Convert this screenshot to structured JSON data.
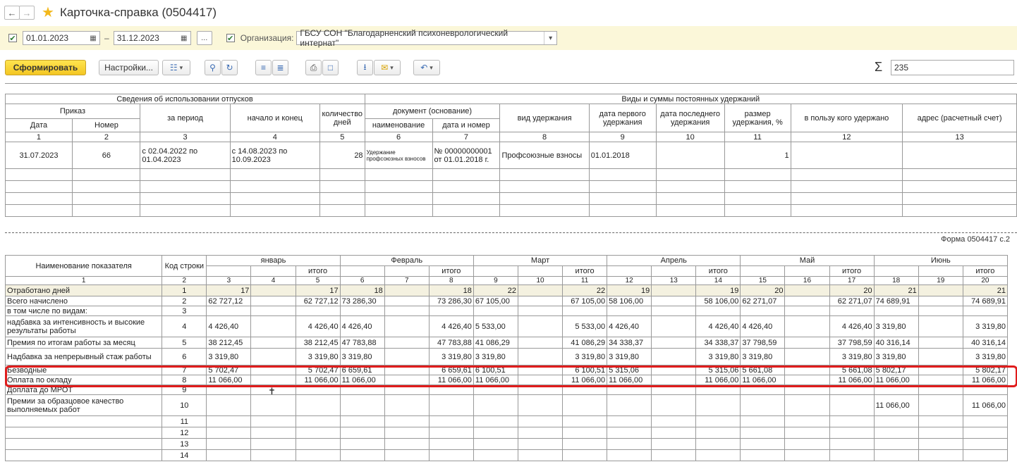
{
  "window": {
    "title": "Карточка-справка (0504417)"
  },
  "filter": {
    "date_from": "01.01.2023",
    "date_sep": "–",
    "date_to": "31.12.2023",
    "dots": "...",
    "org_label": "Организация:",
    "org_value": "ГБСУ СОН \"Благодарненский психоневрологический интернат\""
  },
  "toolbar": {
    "generate": "Сформировать",
    "settings": "Настройки...",
    "sum_value": "235"
  },
  "top_table": {
    "group1": "Сведения об использовании отпусков",
    "group2": "Виды и суммы постоянных удержаний",
    "order": "Приказ",
    "date": "Дата",
    "number": "Номер",
    "period": "за период",
    "start_end": "начало и конец",
    "days": "количество дней",
    "document": "документ (основание)",
    "doc_name": "наименование",
    "doc_date": "дата и номер",
    "deduction_type": "вид удержания",
    "first_date": "дата первого удержания",
    "last_date": "дата последнего удержания",
    "size": "размер удержания, %",
    "recipient": "в пользу кого удержано",
    "address": "адрес (расчетный счет)",
    "nums": [
      "1",
      "2",
      "3",
      "4",
      "5",
      "6",
      "7",
      "8",
      "9",
      "10",
      "11",
      "12",
      "13"
    ],
    "row": {
      "date": "31.07.2023",
      "number": "66",
      "period": "с 02.04.2022 по 01.04.2023",
      "start_end": "с 14.08.2023 по 10.09.2023",
      "days": "28",
      "doc_name": "Удержание профсоюзных взносов",
      "doc_date": "№ 00000000001 от 01.01.2018 г.",
      "deduction_type": "Профсоюзные взносы",
      "first_date": "01.01.2018",
      "size": "1"
    }
  },
  "forma": "Форма 0504417 с.2",
  "bottom_table": {
    "name_header": "Наименование показателя",
    "code_header": "Код строки",
    "months": [
      "январь",
      "Февраль",
      "Март",
      "Апрель",
      "Май",
      "Июнь"
    ],
    "total": "итого",
    "col_nums": [
      "1",
      "2",
      "3",
      "4",
      "5",
      "6",
      "7",
      "8",
      "9",
      "10",
      "11",
      "12",
      "13",
      "14",
      "15",
      "16",
      "17",
      "18",
      "19",
      "20"
    ],
    "rows": [
      {
        "name": "Отработано дней",
        "code": "1",
        "v": [
          "17",
          "",
          "17",
          "18",
          "",
          "18",
          "22",
          "",
          "22",
          "19",
          "",
          "19",
          "20",
          "",
          "20",
          "21",
          "",
          "21"
        ]
      },
      {
        "name": "Всего начислено",
        "code": "2",
        "v": [
          "62 727,12",
          "",
          "62 727,12",
          "73 286,30",
          "",
          "73 286,30",
          "67 105,00",
          "",
          "67 105,00",
          "58 106,00",
          "",
          "58 106,00",
          "62 271,07",
          "",
          "62 271,07",
          "74 689,91",
          "",
          "74 689,91"
        ]
      },
      {
        "name": "в том числе по видам:",
        "code": "3",
        "v": [
          "",
          "",
          "",
          "",
          "",
          "",
          "",
          "",
          "",
          "",
          "",
          "",
          "",
          "",
          "",
          "",
          "",
          ""
        ]
      },
      {
        "name": "надбавка за интенсивность и высокие результаты работы",
        "code": "4",
        "v": [
          "4 426,40",
          "",
          "4 426,40",
          "4 426,40",
          "",
          "4 426,40",
          "5 533,00",
          "",
          "5 533,00",
          "4 426,40",
          "",
          "4 426,40",
          "4 426,40",
          "",
          "4 426,40",
          "3 319,80",
          "",
          "3 319,80"
        ]
      },
      {
        "name": "Премия по итогам работы за месяц",
        "code": "5",
        "v": [
          "38 212,45",
          "",
          "38 212,45",
          "47 783,88",
          "",
          "47 783,88",
          "41 086,29",
          "",
          "41 086,29",
          "34 338,37",
          "",
          "34 338,37",
          "37 798,59",
          "",
          "37 798,59",
          "40 316,14",
          "",
          "40 316,14"
        ]
      },
      {
        "name": "Надбавка за непрерывный стаж работы",
        "code": "6",
        "v": [
          "3 319,80",
          "",
          "3 319,80",
          "3 319,80",
          "",
          "3 319,80",
          "3 319,80",
          "",
          "3 319,80",
          "3 319,80",
          "",
          "3 319,80",
          "3 319,80",
          "",
          "3 319,80",
          "3 319,80",
          "",
          "3 319,80"
        ]
      },
      {
        "name": "Безводные",
        "code": "7",
        "v": [
          "5 702,47",
          "",
          "5 702,47",
          "6 659,61",
          "",
          "6 659,61",
          "6 100,51",
          "",
          "6 100,51",
          "5 315,06",
          "",
          "5 315,06",
          "5 661,08",
          "",
          "5 661,08",
          "5 802,17",
          "",
          "5 802,17"
        ]
      },
      {
        "name": "Оплата по окладу",
        "code": "8",
        "v": [
          "11 066,00",
          "",
          "11 066,00",
          "11 066,00",
          "",
          "11 066,00",
          "11 066,00",
          "",
          "11 066,00",
          "11 066,00",
          "",
          "11 066,00",
          "11 066,00",
          "",
          "11 066,00",
          "11 066,00",
          "",
          "11 066,00"
        ]
      },
      {
        "name": "Доплата до МРОТ",
        "code": "9",
        "v": [
          "",
          "",
          "",
          "",
          "",
          "",
          "",
          "",
          "",
          "",
          "",
          "",
          "",
          "",
          "",
          "",
          "",
          ""
        ]
      },
      {
        "name": "Премии за образцовое качество выполняемых работ",
        "code": "10",
        "v": [
          "",
          "",
          "",
          "",
          "",
          "",
          "",
          "",
          "",
          "",
          "",
          "",
          "",
          "",
          "",
          "11 066,00",
          "",
          "11 066,00"
        ]
      },
      {
        "name": "",
        "code": "11",
        "v": [
          "",
          "",
          "",
          "",
          "",
          "",
          "",
          "",
          "",
          "",
          "",
          "",
          "",
          "",
          "",
          "",
          "",
          ""
        ]
      },
      {
        "name": "",
        "code": "12",
        "v": [
          "",
          "",
          "",
          "",
          "",
          "",
          "",
          "",
          "",
          "",
          "",
          "",
          "",
          "",
          "",
          "",
          "",
          ""
        ]
      },
      {
        "name": "",
        "code": "13",
        "v": [
          "",
          "",
          "",
          "",
          "",
          "",
          "",
          "",
          "",
          "",
          "",
          "",
          "",
          "",
          "",
          "",
          "",
          ""
        ]
      },
      {
        "name": "",
        "code": "14",
        "v": [
          "",
          "",
          "",
          "",
          "",
          "",
          "",
          "",
          "",
          "",
          "",
          "",
          "",
          "",
          "",
          "",
          "",
          ""
        ]
      }
    ]
  },
  "colors": {
    "accent": "#f3c623",
    "filter_bg": "#fbf7d9",
    "highlight": "#e01c1c"
  }
}
